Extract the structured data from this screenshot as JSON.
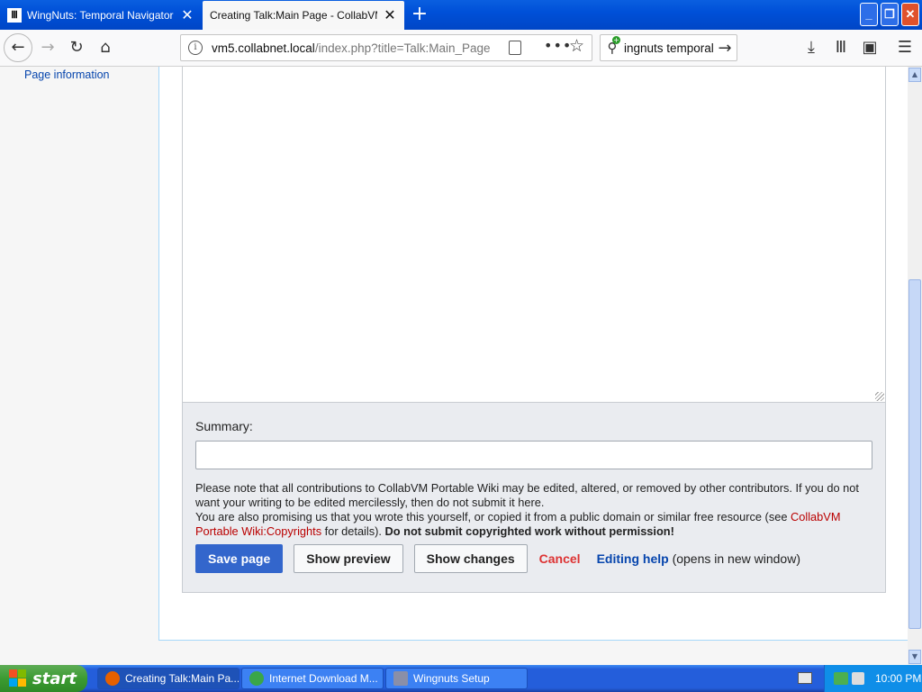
{
  "browser": {
    "tabs": [
      {
        "title": "WingNuts: Temporal Navigator : F",
        "active": false
      },
      {
        "title": "Creating Talk:Main Page - CollabVM Po",
        "active": true
      }
    ],
    "url": {
      "host": "vm5.collabnet.local",
      "path": "/index.php?title=Talk:Main_Page"
    },
    "search": {
      "value": "ingnuts temporal"
    },
    "window_buttons": {
      "minimize": "_",
      "maximize": "❐",
      "close": "✕"
    }
  },
  "sidebar": {
    "page_information": "Page information"
  },
  "edit_form": {
    "summary_label": "Summary:",
    "summary_value": "",
    "notice_line1": "Please note that all contributions to CollabVM Portable Wiki may be edited, altered, or removed by other contributors. If you do not want your writing to be edited mercilessly, then do not submit it here.",
    "notice_line2_pre": "You are also promising us that you wrote this yourself, or copied it from a public domain or similar free resource (see ",
    "notice_copyrights_link": "CollabVM Portable Wiki:Copyrights",
    "notice_line2_post": " for details). ",
    "notice_warning": "Do not submit copyrighted work without permission!",
    "save_label": "Save page",
    "preview_label": "Show preview",
    "changes_label": "Show changes",
    "cancel_label": "Cancel",
    "help_link": "Editing help",
    "help_suffix": " (opens in new window)"
  },
  "taskbar": {
    "start_label": "start",
    "items": [
      {
        "label": "Creating Talk:Main Pa..."
      },
      {
        "label": "Internet Download M..."
      },
      {
        "label": "Wingnuts Setup"
      }
    ],
    "clock": "10:00 PM"
  },
  "colors": {
    "accent": "#3366cc",
    "link": "#0645ad",
    "cancel": "#dd3333",
    "taskbar": "#245edb"
  }
}
